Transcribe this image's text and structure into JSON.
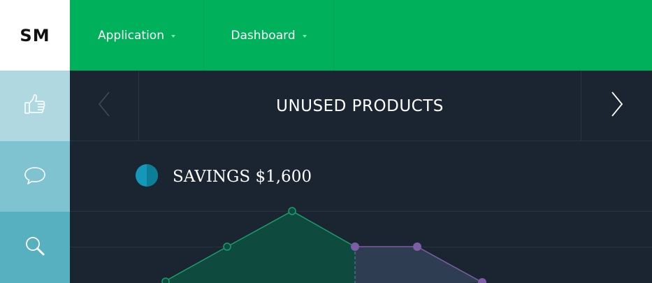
{
  "logo": {
    "text": "SM"
  },
  "sidebar": {
    "items": [
      {
        "icon": "thumbs-up-icon",
        "bg": "#b0d8e0"
      },
      {
        "icon": "chat-bubble-icon",
        "bg": "#7fc3d1"
      },
      {
        "icon": "search-icon",
        "bg": "#56b0c0"
      }
    ]
  },
  "topbar": {
    "menus": [
      {
        "label": "Application"
      },
      {
        "label": "Dashboard"
      }
    ]
  },
  "header": {
    "title": "UNUSED PRODUCTS"
  },
  "savings": {
    "label": "SAVINGS $1,600"
  },
  "colors": {
    "brand_green": "#00b05a",
    "background": "#1b2532",
    "chart_green": "#1a9d6e",
    "chart_purple": "#7d5ea6",
    "savings_dot": "#1497b8"
  }
}
